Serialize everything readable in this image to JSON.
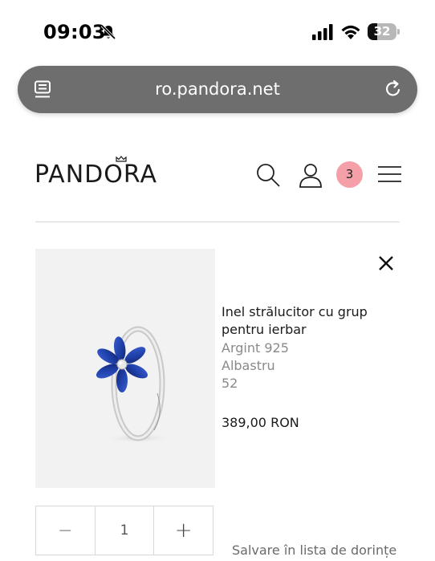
{
  "status_bar": {
    "time": "09:03",
    "battery_level": "32",
    "battery_fraction": 0.32
  },
  "browser": {
    "url": "ro.pandora.net"
  },
  "header": {
    "logo": "PANDORA",
    "cart_count": "3"
  },
  "product": {
    "name": "Inel strălucitor cu grup pentru ierbar",
    "material": "Argint 925",
    "color": "Albastru",
    "size": "52",
    "price": "389,00 RON",
    "quantity": "1",
    "decrease_label": "−",
    "increase_label": "+",
    "wishlist_label": "Salvare în lista de dorințe"
  },
  "colors": {
    "cart_badge": "#f5a0a8",
    "url_bar": "#6e6e6e",
    "stone_blue": "#1f3fa8"
  }
}
